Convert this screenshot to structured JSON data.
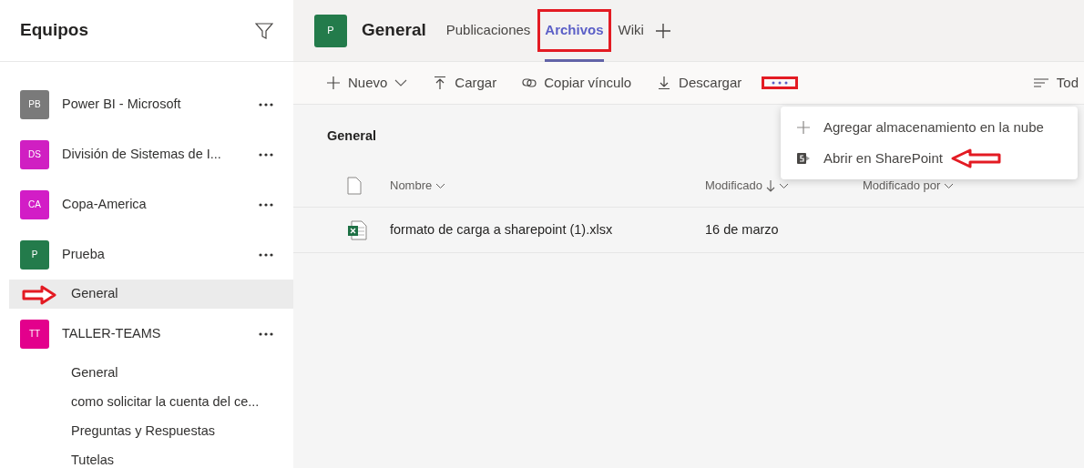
{
  "sidebar": {
    "title": "Equipos",
    "teams": [
      {
        "initials": "PB",
        "name": "Power BI - Microsoft",
        "color": "#7a7a7a"
      },
      {
        "initials": "DS",
        "name": "División de Sistemas de I...",
        "color": "#d01fc2"
      },
      {
        "initials": "CA",
        "name": "Copa-America",
        "color": "#d21dc6"
      },
      {
        "initials": "P",
        "name": "Prueba",
        "color": "#237b4b",
        "channels": [
          {
            "name": "General",
            "selected": true,
            "arrow": true
          }
        ]
      },
      {
        "initials": "TT",
        "name": "TALLER-TEAMS",
        "color": "#e3008c",
        "channels": [
          {
            "name": "General",
            "selected": false,
            "arrow": false
          },
          {
            "name": "como solicitar la cuenta del ce...",
            "selected": false,
            "arrow": false
          },
          {
            "name": "Preguntas y Respuestas",
            "selected": false,
            "arrow": false
          },
          {
            "name": "Tutelas",
            "selected": false,
            "arrow": false
          }
        ]
      }
    ]
  },
  "header": {
    "initials": "P",
    "color": "#237b4b",
    "title": "General",
    "tabs": [
      {
        "label": "Publicaciones",
        "selected": false,
        "boxed": false
      },
      {
        "label": "Archivos",
        "selected": true,
        "boxed": true
      },
      {
        "label": "Wiki",
        "selected": false,
        "boxed": false
      }
    ]
  },
  "toolbar": {
    "items": [
      {
        "kind": "new",
        "label": "Nuevo"
      },
      {
        "kind": "upload",
        "label": "Cargar"
      },
      {
        "kind": "link",
        "label": "Copiar vínculo"
      },
      {
        "kind": "download",
        "label": "Descargar"
      },
      {
        "kind": "more",
        "boxed": true
      }
    ],
    "view": "Tod"
  },
  "section_title": "General",
  "menu": {
    "items": [
      {
        "kind": "add",
        "label": "Agregar almacenamiento en la nube",
        "arrow": false
      },
      {
        "kind": "sharepoint",
        "label": "Abrir en SharePoint",
        "arrow": true
      }
    ]
  },
  "table": {
    "columns": [
      "Nombre",
      "Modificado",
      "Modificado por"
    ],
    "rows": [
      {
        "name": "formato de carga a sharepoint (1).xlsx",
        "modified": "16 de marzo"
      }
    ]
  }
}
